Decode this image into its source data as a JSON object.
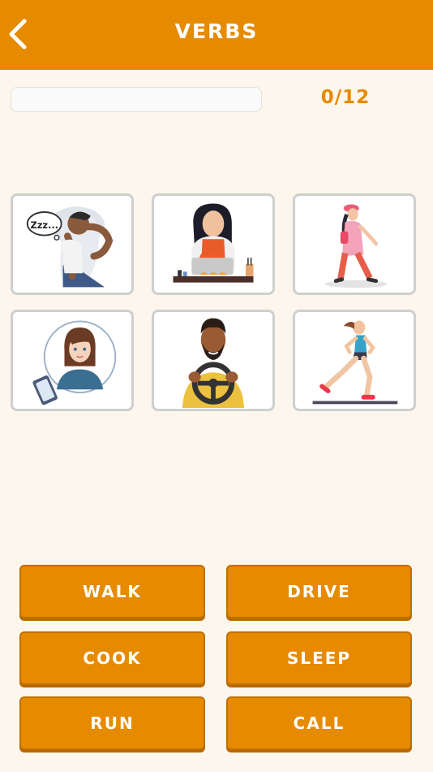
{
  "header": {
    "title": "VERBS",
    "back_icon": "chevron-left-icon"
  },
  "progress": {
    "text": "0/12",
    "fraction": 0
  },
  "colors": {
    "accent": "#e68a00",
    "background": "#fdf6ec",
    "card_border": "#cfcfcf"
  },
  "images": [
    {
      "icon": "sleeping-person-icon",
      "bubble_text": "Zzz..."
    },
    {
      "icon": "cooking-woman-icon"
    },
    {
      "icon": "walking-woman-icon"
    },
    {
      "icon": "woman-on-phone-icon"
    },
    {
      "icon": "driving-man-icon"
    },
    {
      "icon": "running-woman-icon"
    }
  ],
  "answers": [
    "WALK",
    "DRIVE",
    "COOK",
    "SLEEP",
    "RUN",
    "CALL"
  ]
}
